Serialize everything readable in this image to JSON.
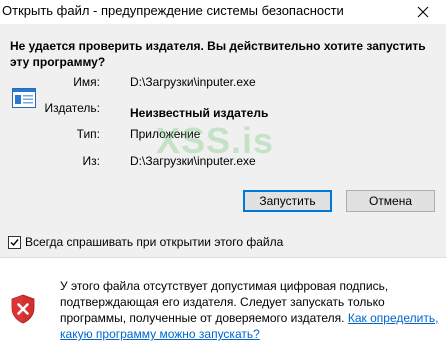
{
  "window": {
    "title": "Открыть файл - предупреждение системы безопасности",
    "close_glyph": "✕"
  },
  "dialog": {
    "heading": "Не удается проверить издателя.  Вы действительно хотите запустить эту программу?",
    "app_icon": "application-window-icon",
    "fields": {
      "name_label": "Имя:",
      "name_value": "D:\\Загрузки\\inputer.exe",
      "publisher_label": "Издатель:",
      "publisher_value": "Неизвестный издатель",
      "type_label": "Тип:",
      "type_value": "Приложение",
      "from_label": "Из:",
      "from_value": "D:\\Загрузки\\inputer.exe"
    },
    "buttons": {
      "run": "Запустить",
      "cancel": "Отмена"
    },
    "checkbox": {
      "label": "Всегда спрашивать при открытии этого файла",
      "checked": true
    }
  },
  "warning": {
    "icon": "shield-error-icon",
    "text": "У этого файла отсутствует допустимая цифровая подпись, подтверждающая его издателя.  Следует запускать только программы, полученные от доверяемого издателя. ",
    "link": "Как определить, какую программу можно запускать?"
  },
  "watermark": "XSS.is",
  "colors": {
    "upper_bg": "#f0f0f0",
    "button_bg": "#e1e1e1",
    "default_border": "#0078d7",
    "link": "#0066cc",
    "shield_red": "#d32f2f"
  }
}
